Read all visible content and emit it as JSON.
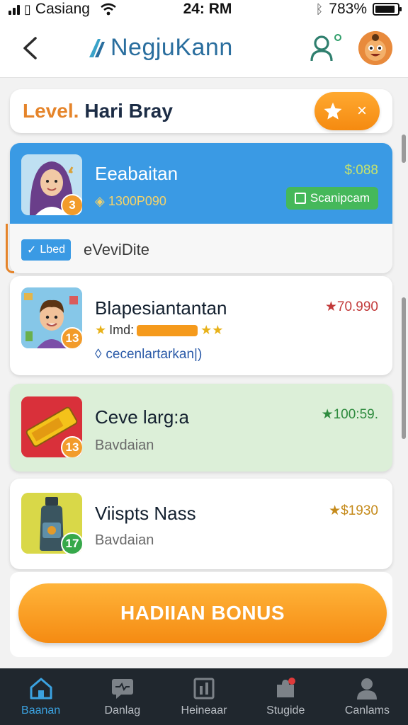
{
  "status_bar": {
    "carrier": "Casiang",
    "time": "24: RM",
    "battery": "783%"
  },
  "header": {
    "app_name": "NegjuKann",
    "icons": [
      "back-icon",
      "user-icon",
      "avatar"
    ]
  },
  "level_banner": {
    "label": "Level.",
    "name": "Hari Bray",
    "pill_close": "×"
  },
  "cards": [
    {
      "title": "Eeabaitan",
      "price": "$:088",
      "badge": "3",
      "points": "1300P090",
      "action": "Scanipcam",
      "chip": "Lbed",
      "footer_text": "eVeviDite"
    },
    {
      "title": "Blapesiantantan",
      "price": "★70.990",
      "badge": "13",
      "rating_text": "Imd:",
      "link_text": "cecenlartarkan|)"
    },
    {
      "title": "Ceve larg:a",
      "price": "★100:59.",
      "badge": "13",
      "subtitle": "Bavdaian"
    },
    {
      "title": "Viispts Nass",
      "price": "★$1930",
      "badge": "17",
      "subtitle": "Bavdaian"
    }
  ],
  "bonus_button": "HADIIAN BONUS",
  "bottom_nav": [
    {
      "label": "Baanan",
      "icon": "home-icon",
      "active": true
    },
    {
      "label": "Danlag",
      "icon": "chat-icon",
      "active": false
    },
    {
      "label": "Heineaar",
      "icon": "chart-icon",
      "active": false
    },
    {
      "label": "Stugide",
      "icon": "puzzle-icon",
      "active": false
    },
    {
      "label": "Canlams",
      "icon": "profile-icon",
      "active": false
    }
  ],
  "colors": {
    "accent_blue": "#3a9ae4",
    "accent_orange": "#f58b12",
    "green_card": "#dcefd8",
    "nav_bg": "#20272e"
  }
}
